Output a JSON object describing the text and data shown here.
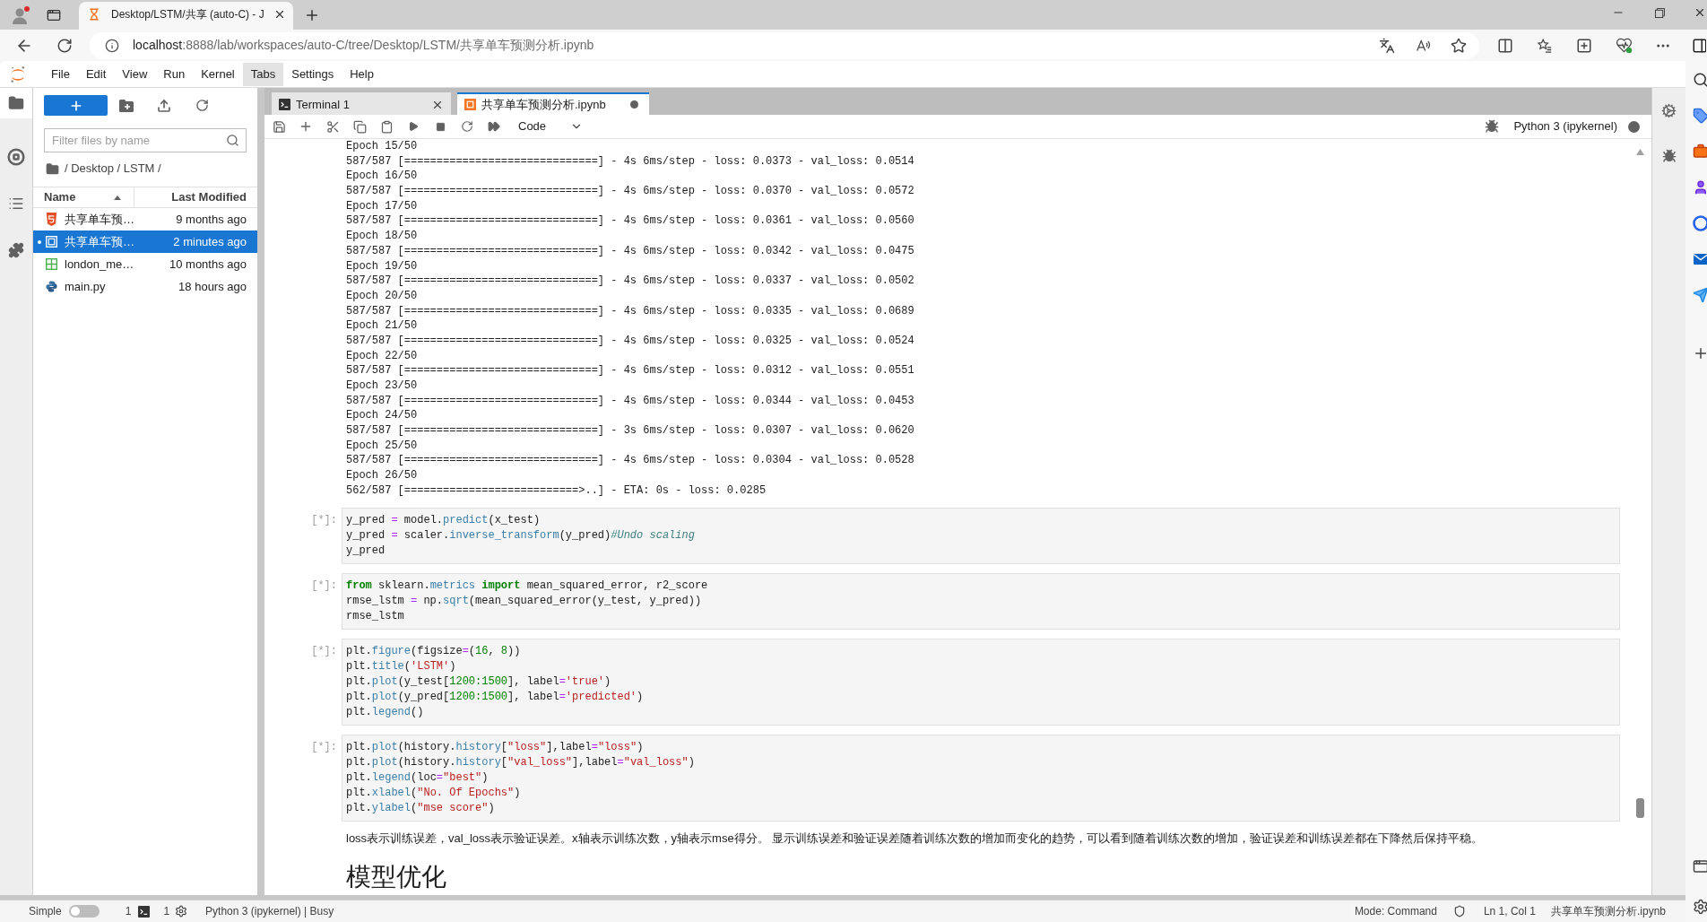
{
  "browser": {
    "tab": {
      "title": "Desktop/LSTM/共享 (auto-C) - J"
    },
    "address": {
      "host": "localhost",
      "path": ":8888/lab/workspaces/auto-C/tree/Desktop/LSTM/共享单车预测分析.ipynb"
    }
  },
  "menu": [
    {
      "label": "File",
      "selected": false
    },
    {
      "label": "Edit",
      "selected": false
    },
    {
      "label": "View",
      "selected": false
    },
    {
      "label": "Run",
      "selected": false
    },
    {
      "label": "Kernel",
      "selected": false
    },
    {
      "label": "Tabs",
      "selected": true
    },
    {
      "label": "Settings",
      "selected": false
    },
    {
      "label": "Help",
      "selected": false
    }
  ],
  "activity_bar": [
    {
      "kind": "files",
      "selected": true
    },
    {
      "kind": "running",
      "selected": false
    },
    {
      "kind": "toc",
      "selected": false
    },
    {
      "kind": "extensions",
      "selected": false
    }
  ],
  "file_browser": {
    "filter": {
      "placeholder": "Filter files by name"
    },
    "breadcrumb": "/ Desktop / LSTM /",
    "columns": [
      {
        "label": "Name",
        "sorted": true
      },
      {
        "label": "Last Modified",
        "sorted": false
      }
    ],
    "files": [
      {
        "kind": "html",
        "name": "共享单车预…",
        "modified": "9 months ago",
        "selected": false,
        "open": false
      },
      {
        "kind": "notebook",
        "name": "共享单车预…",
        "modified": "2 minutes ago",
        "selected": true,
        "open": true
      },
      {
        "kind": "spreadsheet",
        "name": "london_me…",
        "modified": "10 months ago",
        "selected": false,
        "open": false
      },
      {
        "kind": "python",
        "name": "main.py",
        "modified": "18 hours ago",
        "selected": false,
        "open": false
      }
    ]
  },
  "notebook": {
    "tabs": [
      {
        "kind": "terminal",
        "label": "Terminal 1",
        "selected": false,
        "modified": false
      },
      {
        "kind": "notebook",
        "label": "共享单车预测分析.ipynb",
        "selected": true,
        "modified": true
      }
    ],
    "toolbar": {
      "cell_type": "Code",
      "kernel": {
        "name": "Python 3 (ipykernel)",
        "busy": true
      }
    },
    "output_lines": [
      "Epoch 15/50",
      "587/587 [==============================] - 4s 6ms/step - loss: 0.0373 - val_loss: 0.0514",
      "Epoch 16/50",
      "587/587 [==============================] - 4s 6ms/step - loss: 0.0370 - val_loss: 0.0572",
      "Epoch 17/50",
      "587/587 [==============================] - 4s 6ms/step - loss: 0.0361 - val_loss: 0.0560",
      "Epoch 18/50",
      "587/587 [==============================] - 4s 6ms/step - loss: 0.0342 - val_loss: 0.0475",
      "Epoch 19/50",
      "587/587 [==============================] - 4s 6ms/step - loss: 0.0337 - val_loss: 0.0502",
      "Epoch 20/50",
      "587/587 [==============================] - 4s 6ms/step - loss: 0.0335 - val_loss: 0.0689",
      "Epoch 21/50",
      "587/587 [==============================] - 4s 6ms/step - loss: 0.0325 - val_loss: 0.0524",
      "Epoch 22/50",
      "587/587 [==============================] - 4s 6ms/step - loss: 0.0312 - val_loss: 0.0551",
      "Epoch 23/50",
      "587/587 [==============================] - 4s 6ms/step - loss: 0.0344 - val_loss: 0.0453",
      "Epoch 24/50",
      "587/587 [==============================] - 3s 6ms/step - loss: 0.0307 - val_loss: 0.0620",
      "Epoch 25/50",
      "587/587 [==============================] - 4s 6ms/step - loss: 0.0304 - val_loss: 0.0528",
      "Epoch 26/50",
      "562/587 [===========================>..] - ETA: 0s - loss: 0.0285"
    ],
    "cells": [
      {
        "prompt": "[*]:",
        "lines": [
          [
            {
              "text": "y_pred ",
              "kind": "plain"
            },
            {
              "text": "=",
              "kind": "operator"
            },
            {
              "text": " model.",
              "kind": "plain"
            },
            {
              "text": "predict",
              "kind": "method"
            },
            {
              "text": "(x_test)",
              "kind": "plain"
            }
          ],
          [
            {
              "text": "y_pred ",
              "kind": "plain"
            },
            {
              "text": "=",
              "kind": "operator"
            },
            {
              "text": " scaler.",
              "kind": "plain"
            },
            {
              "text": "inverse_transform",
              "kind": "method"
            },
            {
              "text": "(y_pred)",
              "kind": "plain"
            },
            {
              "text": "#Undo scaling",
              "kind": "comment"
            }
          ],
          [
            {
              "text": "y_pred",
              "kind": "plain"
            }
          ]
        ]
      },
      {
        "prompt": "[*]:",
        "lines": [
          [
            {
              "text": "from",
              "kind": "keyword"
            },
            {
              "text": " sklearn.",
              "kind": "plain"
            },
            {
              "text": "metrics",
              "kind": "method"
            },
            {
              "text": " import",
              "kind": "keyword"
            },
            {
              "text": " mean_squared_error, r2_score",
              "kind": "plain"
            }
          ],
          [
            {
              "text": "rmse_lstm ",
              "kind": "plain"
            },
            {
              "text": "=",
              "kind": "operator"
            },
            {
              "text": " np.",
              "kind": "plain"
            },
            {
              "text": "sqrt",
              "kind": "method"
            },
            {
              "text": "(mean_squared_error(y_test, y_pred))",
              "kind": "plain"
            }
          ],
          [
            {
              "text": "rmse_lstm",
              "kind": "plain"
            }
          ]
        ]
      },
      {
        "prompt": "[*]:",
        "lines": [
          [
            {
              "text": "plt.",
              "kind": "plain"
            },
            {
              "text": "figure",
              "kind": "method"
            },
            {
              "text": "(figsize",
              "kind": "plain"
            },
            {
              "text": "=",
              "kind": "operator"
            },
            {
              "text": "(",
              "kind": "plain"
            },
            {
              "text": "16",
              "kind": "number"
            },
            {
              "text": ", ",
              "kind": "plain"
            },
            {
              "text": "8",
              "kind": "number"
            },
            {
              "text": "))",
              "kind": "plain"
            }
          ],
          [
            {
              "text": "plt.",
              "kind": "plain"
            },
            {
              "text": "title",
              "kind": "method"
            },
            {
              "text": "(",
              "kind": "plain"
            },
            {
              "text": "'LSTM'",
              "kind": "string"
            },
            {
              "text": ")",
              "kind": "plain"
            }
          ],
          [
            {
              "text": "plt.",
              "kind": "plain"
            },
            {
              "text": "plot",
              "kind": "method"
            },
            {
              "text": "(y_test[",
              "kind": "plain"
            },
            {
              "text": "1200:1500",
              "kind": "number"
            },
            {
              "text": "], label",
              "kind": "plain"
            },
            {
              "text": "=",
              "kind": "operator"
            },
            {
              "text": "'true'",
              "kind": "string"
            },
            {
              "text": ")",
              "kind": "plain"
            }
          ],
          [
            {
              "text": "plt.",
              "kind": "plain"
            },
            {
              "text": "plot",
              "kind": "method"
            },
            {
              "text": "(y_pred[",
              "kind": "plain"
            },
            {
              "text": "1200:1500",
              "kind": "number"
            },
            {
              "text": "], label",
              "kind": "plain"
            },
            {
              "text": "=",
              "kind": "operator"
            },
            {
              "text": "'predicted'",
              "kind": "string"
            },
            {
              "text": ")",
              "kind": "plain"
            }
          ],
          [
            {
              "text": "plt.",
              "kind": "plain"
            },
            {
              "text": "legend",
              "kind": "method"
            },
            {
              "text": "()",
              "kind": "plain"
            }
          ]
        ]
      },
      {
        "prompt": "[*]:",
        "lines": [
          [
            {
              "text": "plt.",
              "kind": "plain"
            },
            {
              "text": "plot",
              "kind": "method"
            },
            {
              "text": "(history.",
              "kind": "plain"
            },
            {
              "text": "history",
              "kind": "method"
            },
            {
              "text": "[",
              "kind": "plain"
            },
            {
              "text": "\"loss\"",
              "kind": "string"
            },
            {
              "text": "],label",
              "kind": "plain"
            },
            {
              "text": "=",
              "kind": "operator"
            },
            {
              "text": "\"loss\"",
              "kind": "string"
            },
            {
              "text": ")",
              "kind": "plain"
            }
          ],
          [
            {
              "text": "plt.",
              "kind": "plain"
            },
            {
              "text": "plot",
              "kind": "method"
            },
            {
              "text": "(history.",
              "kind": "plain"
            },
            {
              "text": "history",
              "kind": "method"
            },
            {
              "text": "[",
              "kind": "plain"
            },
            {
              "text": "\"val_loss\"",
              "kind": "string"
            },
            {
              "text": "],label",
              "kind": "plain"
            },
            {
              "text": "=",
              "kind": "operator"
            },
            {
              "text": "\"val_loss\"",
              "kind": "string"
            },
            {
              "text": ")",
              "kind": "plain"
            }
          ],
          [
            {
              "text": "plt.",
              "kind": "plain"
            },
            {
              "text": "legend",
              "kind": "method"
            },
            {
              "text": "(loc",
              "kind": "plain"
            },
            {
              "text": "=",
              "kind": "operator"
            },
            {
              "text": "\"best\"",
              "kind": "string"
            },
            {
              "text": ")",
              "kind": "plain"
            }
          ],
          [
            {
              "text": "plt.",
              "kind": "plain"
            },
            {
              "text": "xlabel",
              "kind": "method"
            },
            {
              "text": "(",
              "kind": "plain"
            },
            {
              "text": "\"No. Of Epochs\"",
              "kind": "string"
            },
            {
              "text": ")",
              "kind": "plain"
            }
          ],
          [
            {
              "text": "plt.",
              "kind": "plain"
            },
            {
              "text": "ylabel",
              "kind": "method"
            },
            {
              "text": "(",
              "kind": "plain"
            },
            {
              "text": "\"mse score\"",
              "kind": "string"
            },
            {
              "text": ")",
              "kind": "plain"
            }
          ]
        ]
      }
    ],
    "markdown_text": "loss表示训练误差，val_loss表示验证误差。x轴表示训练次数，y轴表示mse得分。 显示训练误差和验证误差随着训练次数的增加而变化的趋势，可以看到随着训练次数的增加，验证误差和训练误差都在下降然后保持平稳。",
    "heading": "模型优化"
  },
  "status_bar": {
    "simple": {
      "label": "Simple",
      "on": false
    },
    "terminals": "1",
    "kernels": "1",
    "kernel_status": "Python 3 (ipykernel) | Busy",
    "mode": "Mode: Command",
    "cursor": "Ln 1, Col 1",
    "file": "共享单车预测分析.ipynb"
  }
}
